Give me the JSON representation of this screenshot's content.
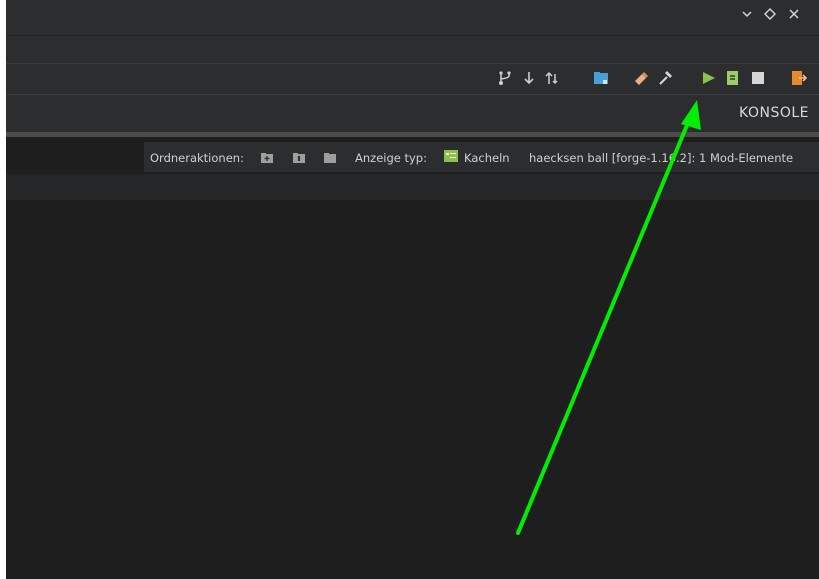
{
  "toolbar": {
    "icons": [
      "branch-icon",
      "pull-icon",
      "sync-icon",
      "folder-icon",
      "eraser-icon",
      "hammer-icon",
      "run-icon",
      "export-icon",
      "stop-icon",
      "exit-icon"
    ]
  },
  "console": {
    "label": "KONSOLE"
  },
  "infobar": {
    "folder_actions_label": "Ordneraktionen:",
    "display_type_label": "Anzeige typ:",
    "display_type_value": "Kacheln",
    "workspace_info": "haecksen ball [forge-1.16.2]: 1 Mod-Elemente"
  },
  "colors": {
    "background": "#1e1e1e",
    "panel": "#2b2d2e",
    "run_green": "#8bc34a",
    "accent_orange": "#e68a2e",
    "annotation_arrow": "#00ee00"
  }
}
